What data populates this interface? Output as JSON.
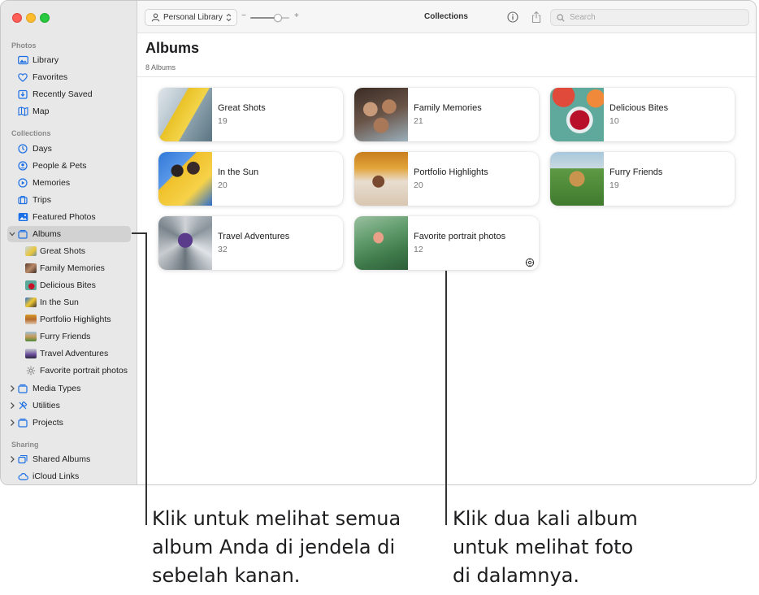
{
  "sidebar": {
    "sections": {
      "photos": "Photos",
      "collections": "Collections",
      "sharing": "Sharing"
    },
    "photos_items": [
      {
        "label": "Library",
        "icon": "photo-library-icon"
      },
      {
        "label": "Favorites",
        "icon": "heart-icon"
      },
      {
        "label": "Recently Saved",
        "icon": "recently-saved-icon"
      },
      {
        "label": "Map",
        "icon": "map-icon"
      }
    ],
    "collections_items": [
      {
        "label": "Days",
        "icon": "clock-icon"
      },
      {
        "label": "People & Pets",
        "icon": "person-circle-icon"
      },
      {
        "label": "Memories",
        "icon": "memories-icon"
      },
      {
        "label": "Trips",
        "icon": "suitcase-icon"
      },
      {
        "label": "Featured Photos",
        "icon": "featured-photos-icon"
      }
    ],
    "albums": {
      "label": "Albums",
      "children": [
        "Great Shots",
        "Family Memories",
        "Delicious Bites",
        "In the Sun",
        "Portfolio Highlights",
        "Furry Friends",
        "Travel Adventures",
        "Favorite portrait photos"
      ]
    },
    "folders": [
      {
        "label": "Media Types",
        "icon": "folder-icon"
      },
      {
        "label": "Utilities",
        "icon": "tools-icon"
      },
      {
        "label": "Projects",
        "icon": "folder-icon"
      }
    ],
    "sharing_items": [
      {
        "label": "Shared Albums",
        "icon": "shared-albums-icon"
      },
      {
        "label": "iCloud Links",
        "icon": "cloud-link-icon"
      }
    ]
  },
  "toolbar": {
    "library_label": "Personal Library",
    "zoom_minus": "−",
    "zoom_plus": "+",
    "zoom_level": 0.7,
    "title": "Collections",
    "search_placeholder": "Search"
  },
  "content": {
    "title": "Albums",
    "subtitle": "8 Albums",
    "albums": [
      {
        "name": "Great Shots",
        "count": "19"
      },
      {
        "name": "Family Memories",
        "count": "21"
      },
      {
        "name": "Delicious Bites",
        "count": "10"
      },
      {
        "name": "In the Sun",
        "count": "20"
      },
      {
        "name": "Portfolio Highlights",
        "count": "20"
      },
      {
        "name": "Furry Friends",
        "count": "19"
      },
      {
        "name": "Travel Adventures",
        "count": "32"
      },
      {
        "name": "Favorite portrait photos",
        "count": "12"
      }
    ]
  },
  "callouts": {
    "left_lines": [
      "Klik untuk melihat semua",
      "album Anda di jendela di",
      "sebelah kanan."
    ],
    "right_lines": [
      "Klik dua kali album",
      "untuk melihat foto",
      "di dalamnya."
    ]
  },
  "colors": {
    "accent": "#1b6fe6",
    "close": "#ff5f57",
    "minimize": "#febc2e",
    "maximize": "#28c840"
  }
}
